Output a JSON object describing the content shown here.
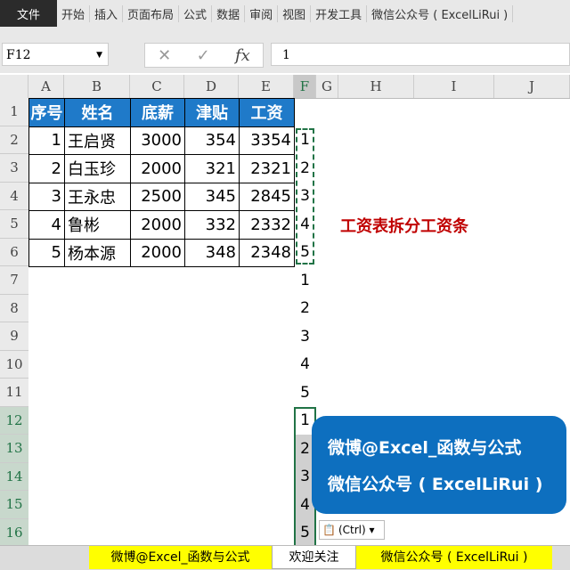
{
  "menu": {
    "file": "文件",
    "items": [
      "开始",
      "插入",
      "页面布局",
      "公式",
      "数据",
      "审阅",
      "视图",
      "开发工具",
      "微信公众号 ( ExcelLiRui )"
    ]
  },
  "namebox": "F12",
  "formula": "1",
  "fx": "fx",
  "cancel": "✕",
  "enter": "✓",
  "columns": [
    "A",
    "B",
    "C",
    "D",
    "E",
    "F",
    "G",
    "H",
    "I",
    "J"
  ],
  "rows": [
    "1",
    "2",
    "3",
    "4",
    "5",
    "6",
    "7",
    "8",
    "9",
    "10",
    "11",
    "12",
    "13",
    "14",
    "15",
    "16"
  ],
  "table": {
    "headers": [
      "序号",
      "姓名",
      "底薪",
      "津贴",
      "工资"
    ],
    "rows": [
      [
        "1",
        "王启贤",
        "3000",
        "354",
        "3354"
      ],
      [
        "2",
        "白玉珍",
        "2000",
        "321",
        "2321"
      ],
      [
        "3",
        "王永忠",
        "2500",
        "345",
        "2845"
      ],
      [
        "4",
        "鲁彬",
        "2000",
        "332",
        "2332"
      ],
      [
        "5",
        "杨本源",
        "2000",
        "348",
        "2348"
      ]
    ]
  },
  "f_column": [
    "1",
    "2",
    "3",
    "4",
    "5",
    "1",
    "2",
    "3",
    "4",
    "5",
    "1",
    "2",
    "3",
    "4",
    "5"
  ],
  "annotation": "工资表拆分工资条",
  "promo": {
    "line1": "微博@Excel_函数与公式",
    "line2": "微信公众号 ( ExcelLiRui )"
  },
  "paste_options": "(Ctrl) ▾",
  "sheet_tabs": [
    "微博@Excel_函数与公式",
    "欢迎关注",
    "微信公众号 ( ExcelLiRui )"
  ],
  "colors": {
    "header_fill": "#1f7ac9",
    "annotation": "#c00000",
    "tab_highlight": "#ffff00"
  }
}
